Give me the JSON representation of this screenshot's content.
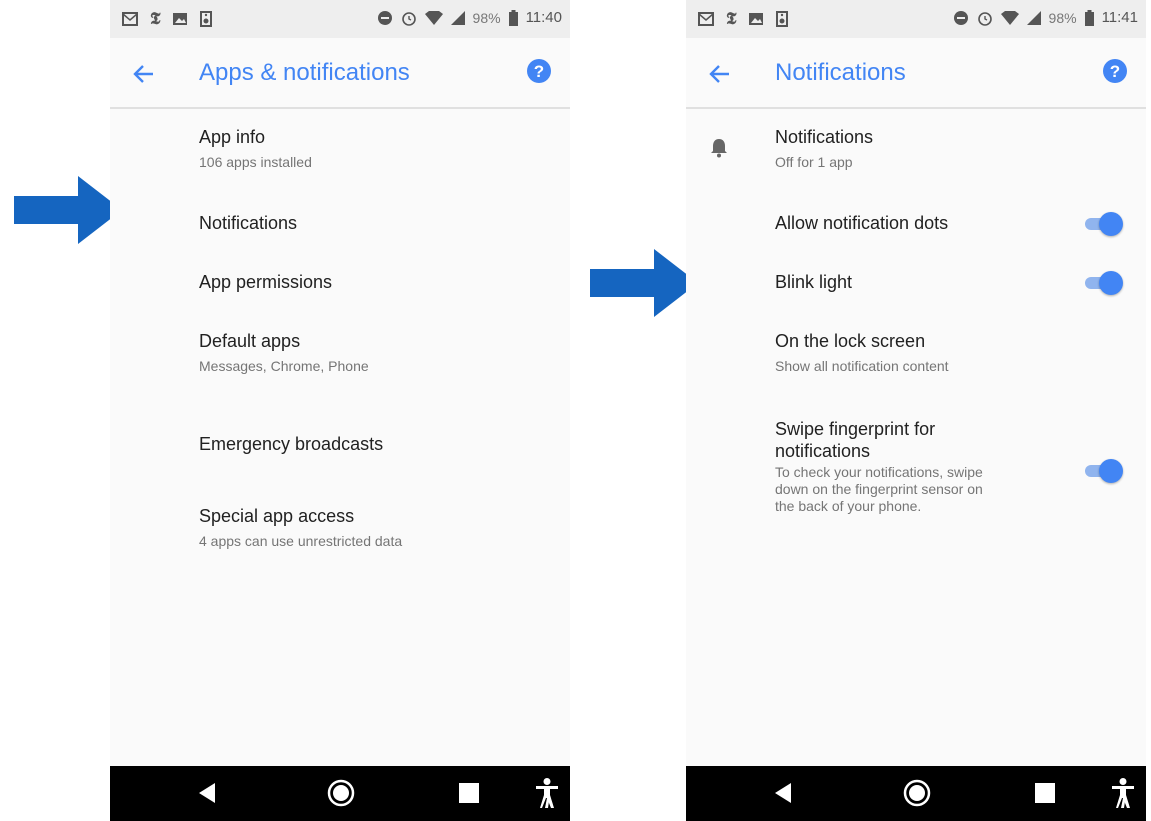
{
  "left": {
    "status": {
      "time": "11:40",
      "battery": "98%"
    },
    "title": "Apps & notifications",
    "items": [
      {
        "title": "App info",
        "subtitle": "106 apps installed"
      },
      {
        "title": "Notifications"
      },
      {
        "title": "App permissions"
      },
      {
        "title": "Default apps",
        "subtitle": "Messages, Chrome, Phone"
      },
      {
        "title": "Emergency broadcasts"
      },
      {
        "title": "Special app access",
        "subtitle": "4 apps can use unrestricted data"
      }
    ]
  },
  "right": {
    "status": {
      "time": "11:41",
      "battery": "98%"
    },
    "title": "Notifications",
    "items": [
      {
        "title": "Notifications",
        "subtitle": "Off for 1 app"
      },
      {
        "title": "Allow notification dots",
        "toggle_on": true
      },
      {
        "title": "Blink light",
        "toggle_on": true
      },
      {
        "title": "On the lock screen",
        "subtitle": "Show all notification content"
      },
      {
        "title_line1": "Swipe fingerprint for",
        "title_line2": "notifications",
        "desc_line1": "To check your notifications, swipe",
        "desc_line2": "down on the fingerprint sensor on",
        "desc_line3": "the back of your phone.",
        "toggle_on": true
      }
    ]
  },
  "icons": {
    "back": "arrow-left-icon",
    "help": "help-circle-icon",
    "bell": "bell-icon",
    "nav_back": "triangle-back-icon",
    "nav_home": "circle-home-icon",
    "nav_recents": "square-recents-icon",
    "accessibility": "accessibility-icon",
    "pointer": "arrow-right-icon"
  },
  "colors": {
    "accent": "#4285f4",
    "pointer_arrow": "#1565c0"
  }
}
